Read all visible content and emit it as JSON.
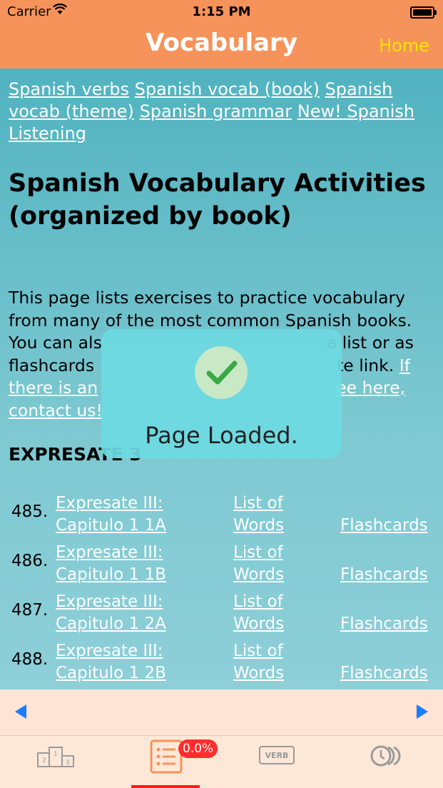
{
  "status": {
    "carrier": "Carrier",
    "time": "1:15 PM"
  },
  "nav": {
    "title": "Vocabulary",
    "home": "Home"
  },
  "links": [
    "Spanish verbs",
    "Spanish vocab (book)",
    "Spanish vocab (theme)",
    "Spanish grammar",
    "New! Spanish Listening"
  ],
  "heading": "Spanish Vocabulary Activities (organized by book)",
  "intro": {
    "line1": "This page lists exercises to practice vocabulary",
    "line2": "from many of the most common Spanish books.",
    "line3a": "You can als",
    "line3b": "a list or as",
    "line4a": "flashcards",
    "line4b": "te link.",
    "line4link": "If",
    "line5a": "there is an",
    "line5b": "ee here,",
    "line6": "contact us!"
  },
  "section_title": "EXPRESATE 3",
  "rows": [
    {
      "num": "485.",
      "title1": "Expresate III:",
      "title2": "Capitulo 1 1A",
      "list1": "List of",
      "list2": "Words",
      "flash": "Flashcards"
    },
    {
      "num": "486.",
      "title1": "Expresate III:",
      "title2": "Capitulo 1 1B",
      "list1": "List of",
      "list2": "Words",
      "flash": "Flashcards"
    },
    {
      "num": "487.",
      "title1": "Expresate III:",
      "title2": "Capitulo 1 2A",
      "list1": "List of",
      "list2": "Words",
      "flash": "Flashcards"
    },
    {
      "num": "488.",
      "title1": "Expresate III:",
      "title2": "Capitulo 1 2B",
      "list1": "List of",
      "list2": "Words",
      "flash": "Flashcards"
    }
  ],
  "toast": {
    "message": "Page Loaded."
  },
  "tabs": {
    "badge": "0.0%",
    "verb_label": "VERB",
    "icons": [
      "podium-icon",
      "list-icon",
      "verb-icon",
      "history-icon"
    ]
  },
  "colors": {
    "nav": "#f6935a",
    "home": "#ffe600",
    "content_top": "#51b3c0",
    "accent_red": "#ff2d2d",
    "tab_active": "#f6935a"
  }
}
